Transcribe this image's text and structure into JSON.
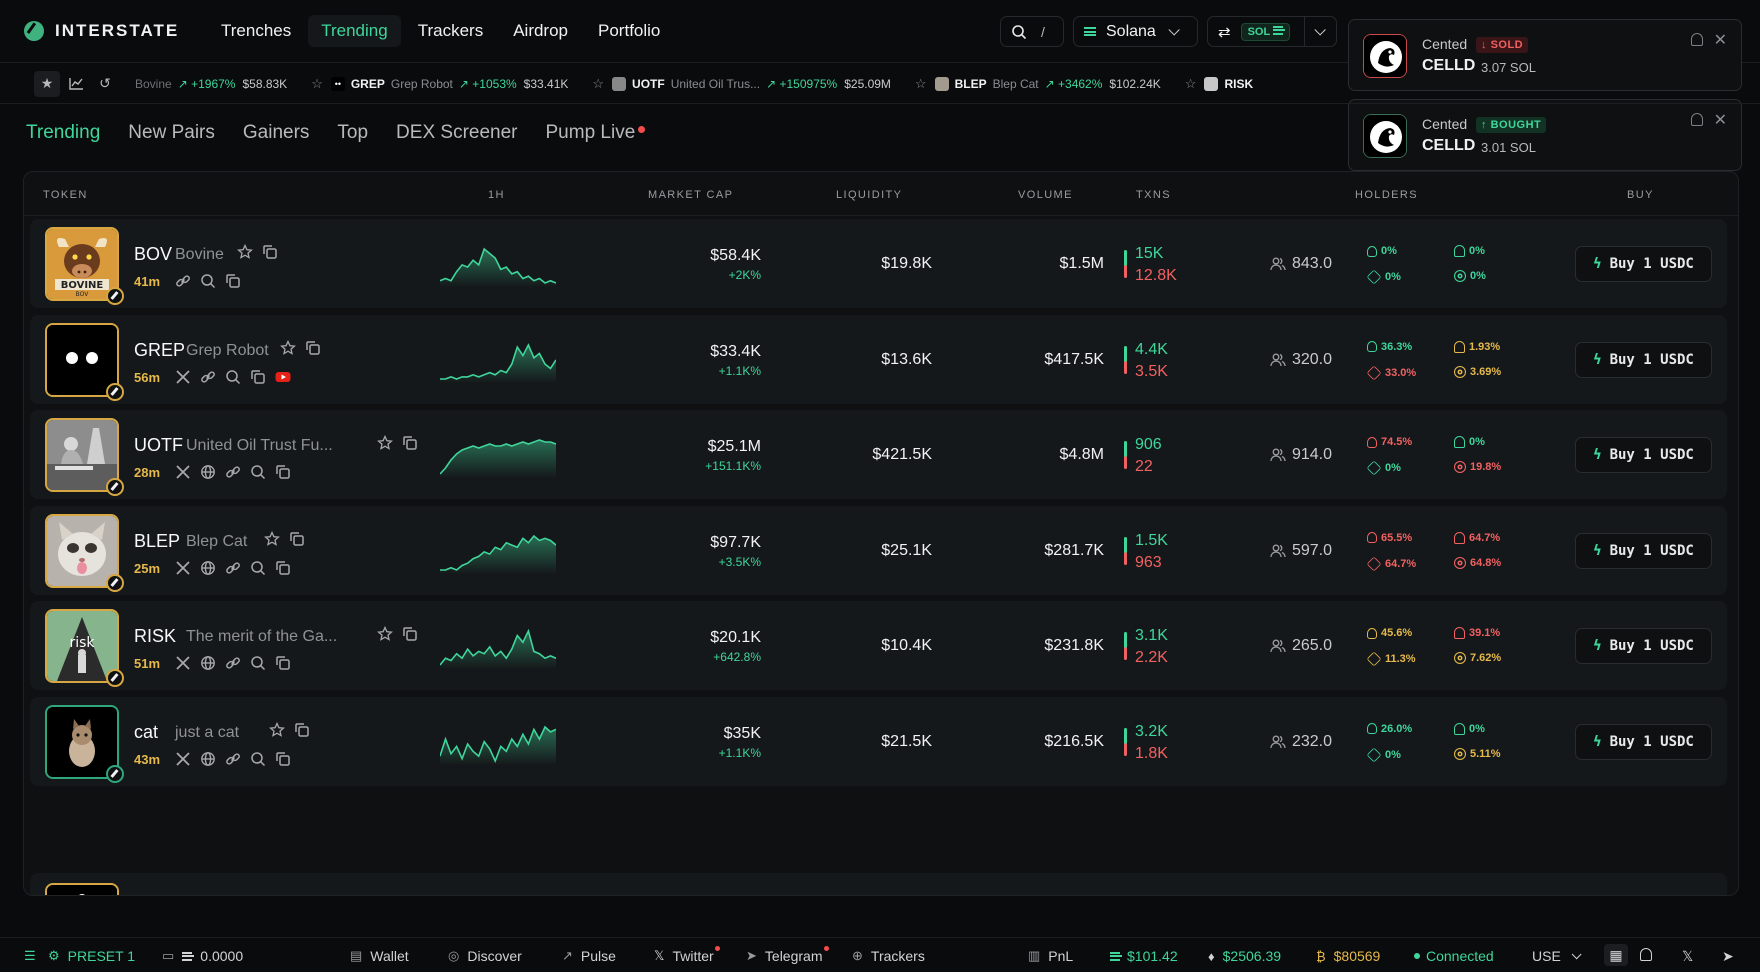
{
  "header": {
    "brand": "INTERSTATE",
    "nav": [
      "Trenches",
      "Trending",
      "Trackers",
      "Airdrop",
      "Portfolio"
    ],
    "active_nav": "Trending",
    "search_shortcut": "/",
    "chain": "Solana",
    "currency_badge": "SOL"
  },
  "toasts": [
    {
      "who": "Cented",
      "type": "SOLD",
      "token": "CELLD",
      "amount": "3.07 SOL"
    },
    {
      "who": "Cented",
      "type": "BOUGHT",
      "token": "CELLD",
      "amount": "3.01 SOL"
    }
  ],
  "ticker": [
    {
      "symbol": "",
      "name": "Bovine",
      "change": "+1967%",
      "cap": "$58.83K",
      "img": "#8a5a2b"
    },
    {
      "symbol": "GREP",
      "name": "Grep Robot",
      "change": "+1053%",
      "cap": "$33.41K",
      "img": "#000000"
    },
    {
      "symbol": "UOTF",
      "name": "United Oil Trus...",
      "change": "+150975%",
      "cap": "$25.09M",
      "img": "#888888"
    },
    {
      "symbol": "BLEP",
      "name": "Blep Cat",
      "change": "+3462%",
      "cap": "$102.24K",
      "img": "#a29a8f"
    },
    {
      "symbol": "RISK",
      "name": "",
      "change": "",
      "cap": "",
      "img": "#c7c7c7"
    }
  ],
  "tabs": [
    "Trending",
    "New Pairs",
    "Gainers",
    "Top",
    "DEX Screener",
    "Pump Live"
  ],
  "columns": [
    "TOKEN",
    "1H",
    "MARKET CAP",
    "LIQUIDITY",
    "VOLUME",
    "TXNS",
    "HOLDERS",
    "BUY"
  ],
  "rows": [
    {
      "symbol": "BOV",
      "name": "Bovine",
      "age": "41m",
      "mcap": "$58.4K",
      "mcap_change": "+2K%",
      "liquidity": "$19.8K",
      "volume": "$1.5M",
      "tx_buy": "15K",
      "tx_sell": "12.8K",
      "holders": "843.0",
      "s1": "0%",
      "s2": "0%",
      "s3": "0%",
      "s4": "0%",
      "buy": "Buy 1 USDC",
      "spark": [
        5,
        6,
        5,
        9,
        12,
        11,
        14,
        12,
        19,
        17,
        15,
        10,
        11,
        8,
        9,
        6,
        7,
        5,
        6,
        4,
        5,
        4
      ],
      "socials": [
        "link",
        "search",
        "copy"
      ],
      "art": "bull"
    },
    {
      "symbol": "GREP",
      "name": "Grep Robot",
      "age": "56m",
      "mcap": "$33.4K",
      "mcap_change": "+1.1K%",
      "liquidity": "$13.6K",
      "volume": "$417.5K",
      "tx_buy": "4.4K",
      "tx_sell": "3.5K",
      "holders": "320.0",
      "s1": "36.3%",
      "s2": "1.93%",
      "s3": "33.0%",
      "s4": "3.69%",
      "buy": "Buy 1 USDC",
      "spark": [
        3,
        3,
        4,
        3,
        4,
        4,
        5,
        4,
        5,
        6,
        5,
        7,
        6,
        10,
        18,
        14,
        19,
        13,
        15,
        10,
        8,
        12
      ],
      "socials": [
        "x",
        "link",
        "search",
        "copy",
        "youtube"
      ],
      "art": "robot"
    },
    {
      "symbol": "UOTF",
      "name": "United Oil Trust Fu...",
      "age": "28m",
      "mcap": "$25.1M",
      "mcap_change": "+151.1K%",
      "liquidity": "$421.5K",
      "volume": "$4.8M",
      "tx_buy": "906",
      "tx_sell": "22",
      "holders": "914.0",
      "s1": "74.5%",
      "s2": "0%",
      "s3": "0%",
      "s4": "19.8%",
      "buy": "Buy 1 USDC",
      "spark": [
        3,
        6,
        10,
        13,
        15,
        16,
        17,
        16,
        17,
        18,
        17,
        17,
        18,
        17,
        18,
        19,
        18,
        19,
        20,
        19,
        19,
        18
      ],
      "socials": [
        "x",
        "globe",
        "link",
        "search",
        "copy"
      ],
      "art": "oil"
    },
    {
      "symbol": "BLEP",
      "name": "Blep Cat",
      "age": "25m",
      "mcap": "$97.7K",
      "mcap_change": "+3.5K%",
      "liquidity": "$25.1K",
      "volume": "$281.7K",
      "tx_buy": "1.5K",
      "tx_sell": "963",
      "holders": "597.0",
      "s1": "65.5%",
      "s2": "64.7%",
      "s3": "64.7%",
      "s4": "64.8%",
      "buy": "Buy 1 USDC",
      "spark": [
        3,
        3,
        4,
        3,
        5,
        6,
        8,
        9,
        11,
        10,
        13,
        12,
        15,
        14,
        13,
        17,
        15,
        18,
        16,
        17,
        16,
        14
      ],
      "socials": [
        "x",
        "globe",
        "link",
        "search",
        "copy"
      ],
      "art": "cat"
    },
    {
      "symbol": "RISK",
      "name": "The merit of the Ga...",
      "age": "51m",
      "mcap": "$20.1K",
      "mcap_change": "+642.8%",
      "liquidity": "$10.4K",
      "volume": "$231.8K",
      "tx_buy": "3.1K",
      "tx_sell": "2.2K",
      "holders": "265.0",
      "s1": "45.6%",
      "s2": "39.1%",
      "s3": "11.3%",
      "s4": "7.62%",
      "buy": "Buy 1 USDC",
      "spark": [
        5,
        8,
        7,
        10,
        8,
        12,
        9,
        11,
        10,
        13,
        9,
        11,
        8,
        12,
        18,
        15,
        20,
        11,
        10,
        8,
        9,
        8
      ],
      "socials": [
        "x",
        "globe",
        "link",
        "search",
        "copy"
      ],
      "art": "risk"
    },
    {
      "symbol": "cat",
      "name": "just a cat",
      "age": "43m",
      "mcap": "$35K",
      "mcap_change": "+1.1K%",
      "liquidity": "$21.5K",
      "volume": "$216.5K",
      "tx_buy": "3.2K",
      "tx_sell": "1.8K",
      "holders": "232.0",
      "s1": "26.0%",
      "s2": "0%",
      "s3": "0%",
      "s4": "5.11%",
      "buy": "Buy 1 USDC",
      "spark": [
        8,
        15,
        9,
        12,
        7,
        13,
        10,
        8,
        14,
        11,
        6,
        12,
        10,
        15,
        12,
        17,
        13,
        19,
        15,
        20,
        18,
        19
      ],
      "socials": [
        "x",
        "globe",
        "link",
        "search",
        "copy"
      ],
      "art": "kitten"
    }
  ],
  "bottom": {
    "preset": "PRESET 1",
    "balance": "0.0000",
    "links": [
      "Wallet",
      "Discover",
      "Pulse",
      "Twitter",
      "Telegram",
      "Trackers"
    ],
    "pnl": "PnL",
    "sol_price": "$101.42",
    "eth_price": "$2506.39",
    "btc_price": "$80569",
    "status": "Connected",
    "region": "USE"
  },
  "colors": {
    "accent": "#3fd69b",
    "sell": "#f26161",
    "warn": "#e5b94b",
    "bg": "#0a0b0c"
  }
}
